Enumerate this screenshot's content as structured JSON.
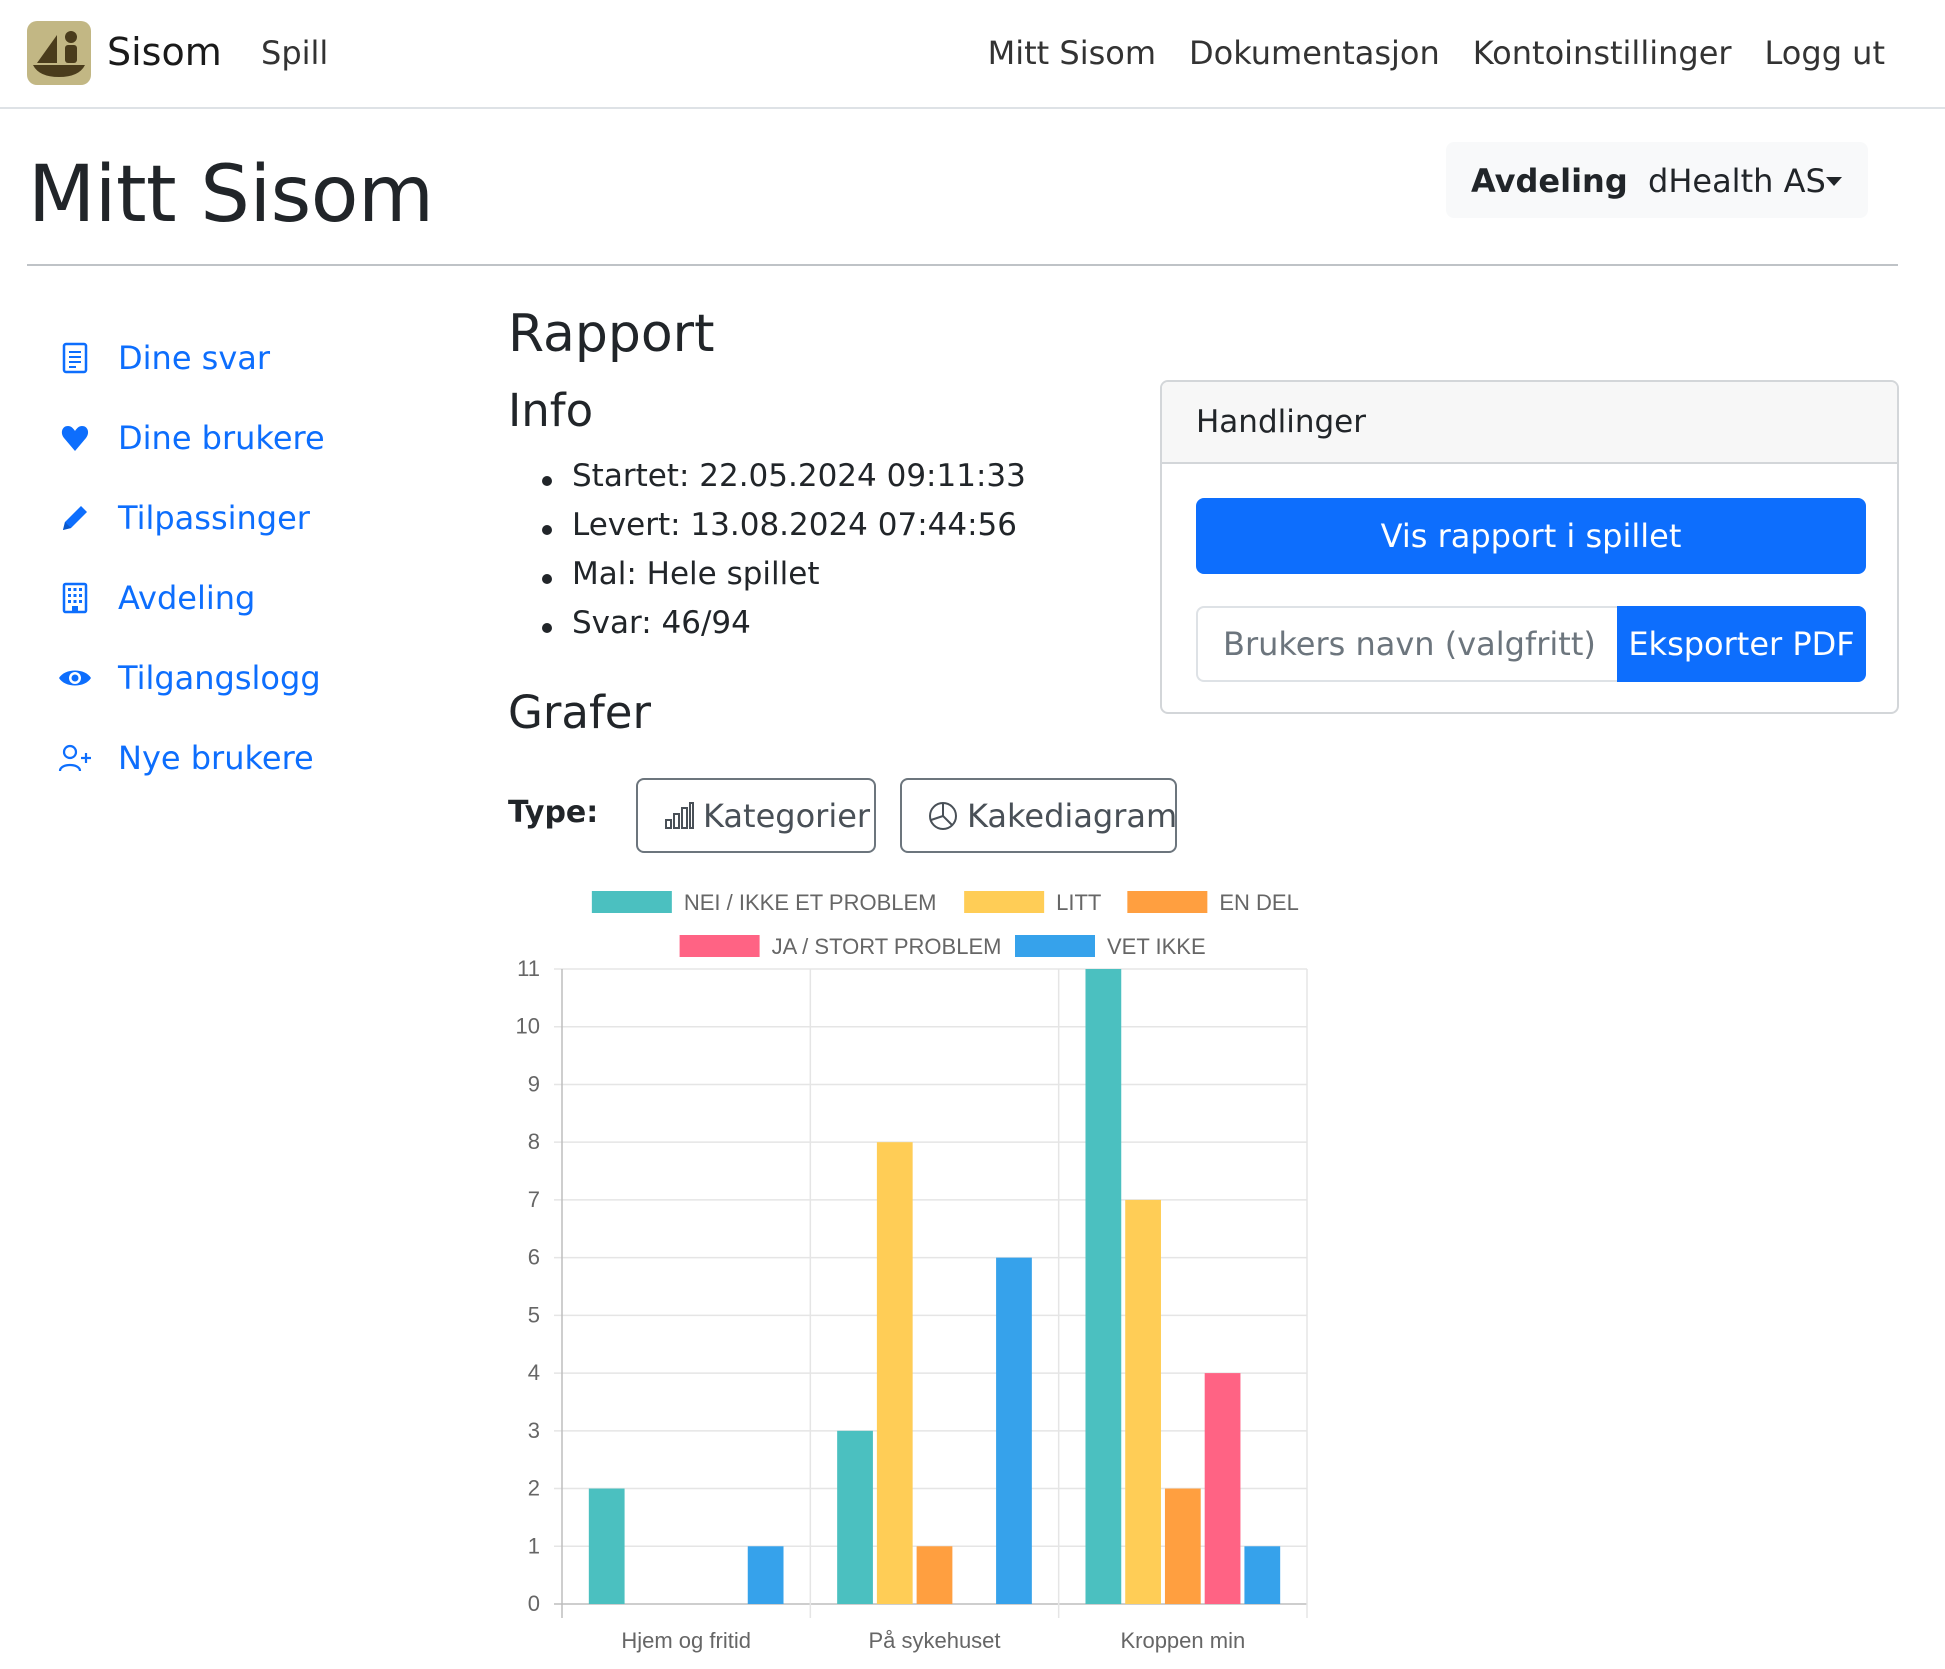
{
  "navbar": {
    "brand": "Sisom",
    "left_links": [
      "Spill"
    ],
    "right_links": [
      "Mitt Sisom",
      "Dokumentasjon",
      "Kontoinstillinger",
      "Logg ut"
    ]
  },
  "header": {
    "title": "Mitt Sisom",
    "department_label": "Avdeling",
    "department_value": "dHealth AS"
  },
  "sidebar": {
    "items": [
      {
        "label": "Dine svar",
        "icon": "document-icon"
      },
      {
        "label": "Dine brukere",
        "icon": "heart-icon"
      },
      {
        "label": "Tilpassinger",
        "icon": "pencil-icon"
      },
      {
        "label": "Avdeling",
        "icon": "building-icon"
      },
      {
        "label": "Tilgangslogg",
        "icon": "eye-icon"
      },
      {
        "label": "Nye brukere",
        "icon": "add-user-icon"
      }
    ]
  },
  "main": {
    "title": "Rapport",
    "info_heading": "Info",
    "info_items": [
      "Startet: 22.05.2024 09:11:33",
      "Levert: 13.08.2024 07:44:56",
      "Mal: Hele spillet",
      "Svar: 46/94"
    ],
    "graphs_heading": "Grafer",
    "type_label": "Type:",
    "type_buttons": [
      "Kategorier",
      "Kakediagram"
    ]
  },
  "actions": {
    "title": "Handlinger",
    "show_report_label": "Vis rapport i spillet",
    "name_placeholder": "Brukers navn (valgfritt)",
    "export_label": "Eksporter PDF"
  },
  "colors": {
    "primary": "#0d6efd",
    "series": [
      "#4bc0c0",
      "#ffcd56",
      "#ff9f40",
      "#ff6384",
      "#36a2eb"
    ]
  },
  "chart_data": {
    "type": "bar",
    "categories": [
      "Hjem og fritid",
      "På sykehuset",
      "Kroppen min"
    ],
    "series": [
      {
        "name": "NEI / IKKE ET PROBLEM",
        "values": [
          2,
          3,
          11
        ]
      },
      {
        "name": "LITT",
        "values": [
          0,
          8,
          7
        ]
      },
      {
        "name": "EN DEL",
        "values": [
          0,
          1,
          2
        ]
      },
      {
        "name": "JA / STORT PROBLEM",
        "values": [
          0,
          0,
          4
        ]
      },
      {
        "name": "VET IKKE",
        "values": [
          1,
          6,
          1
        ]
      }
    ],
    "ylim": [
      0,
      11
    ],
    "yticks": [
      0,
      1,
      2,
      3,
      4,
      5,
      6,
      7,
      8,
      9,
      10,
      11
    ],
    "grid": true,
    "legend_position": "top"
  }
}
